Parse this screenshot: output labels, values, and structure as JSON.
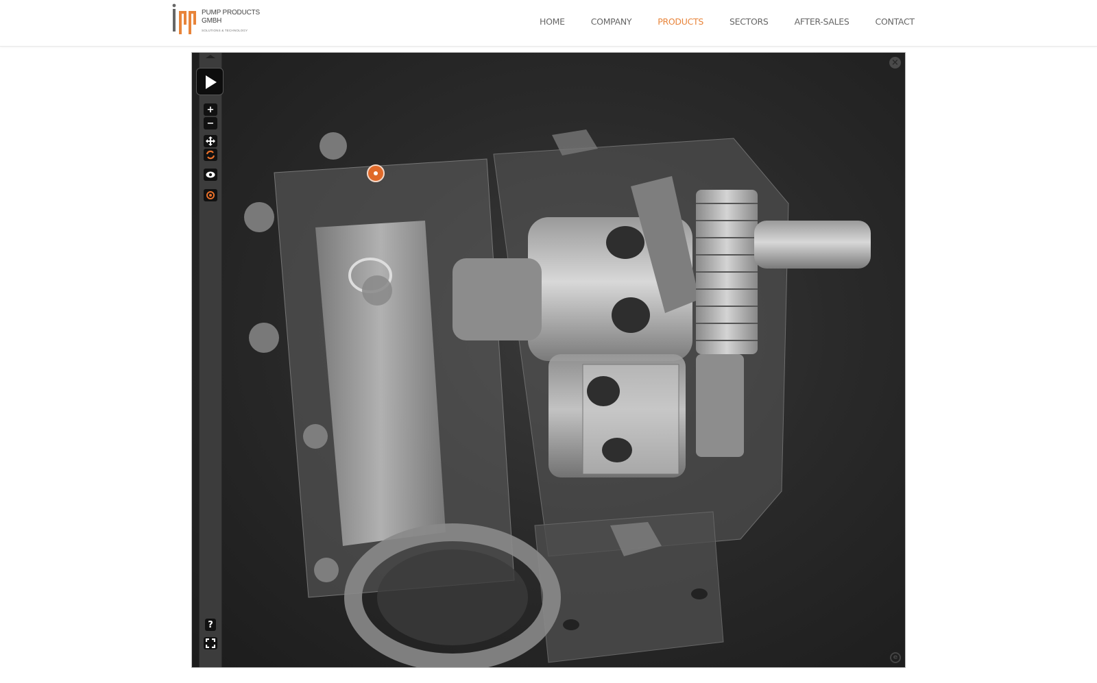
{
  "brand": {
    "logo_letters": "ipp",
    "name_line1": "PUMP PRODUCTS",
    "name_line2": "GMBH",
    "tagline": "SOLUTIONS & TECHNOLOGY",
    "accent_color": "#e8843a"
  },
  "nav": {
    "items": [
      {
        "label": "HOME",
        "active": false
      },
      {
        "label": "COMPANY",
        "active": false
      },
      {
        "label": "PRODUCTS",
        "active": true
      },
      {
        "label": "SECTORS",
        "active": false
      },
      {
        "label": "AFTER-SALES",
        "active": false
      },
      {
        "label": "CONTACT",
        "active": false
      }
    ]
  },
  "viewer": {
    "model": "rotary lobe pump (transparent 3D view)",
    "toolbar": {
      "collapse_icon": "chevron-up-icon",
      "play_icon": "play-icon",
      "zoom_in_label": "+",
      "zoom_out_label": "−",
      "pan_icon": "move-arrows-icon",
      "rotate_icon": "rotate-icon",
      "visibility_icon": "eye-icon",
      "hotspot_icon": "target-icon",
      "help_label": "?",
      "fullscreen_icon": "fullscreen-icon"
    },
    "close_label": "×",
    "brand_badge_label": "e",
    "hotspot_color": "#e06a2a"
  }
}
